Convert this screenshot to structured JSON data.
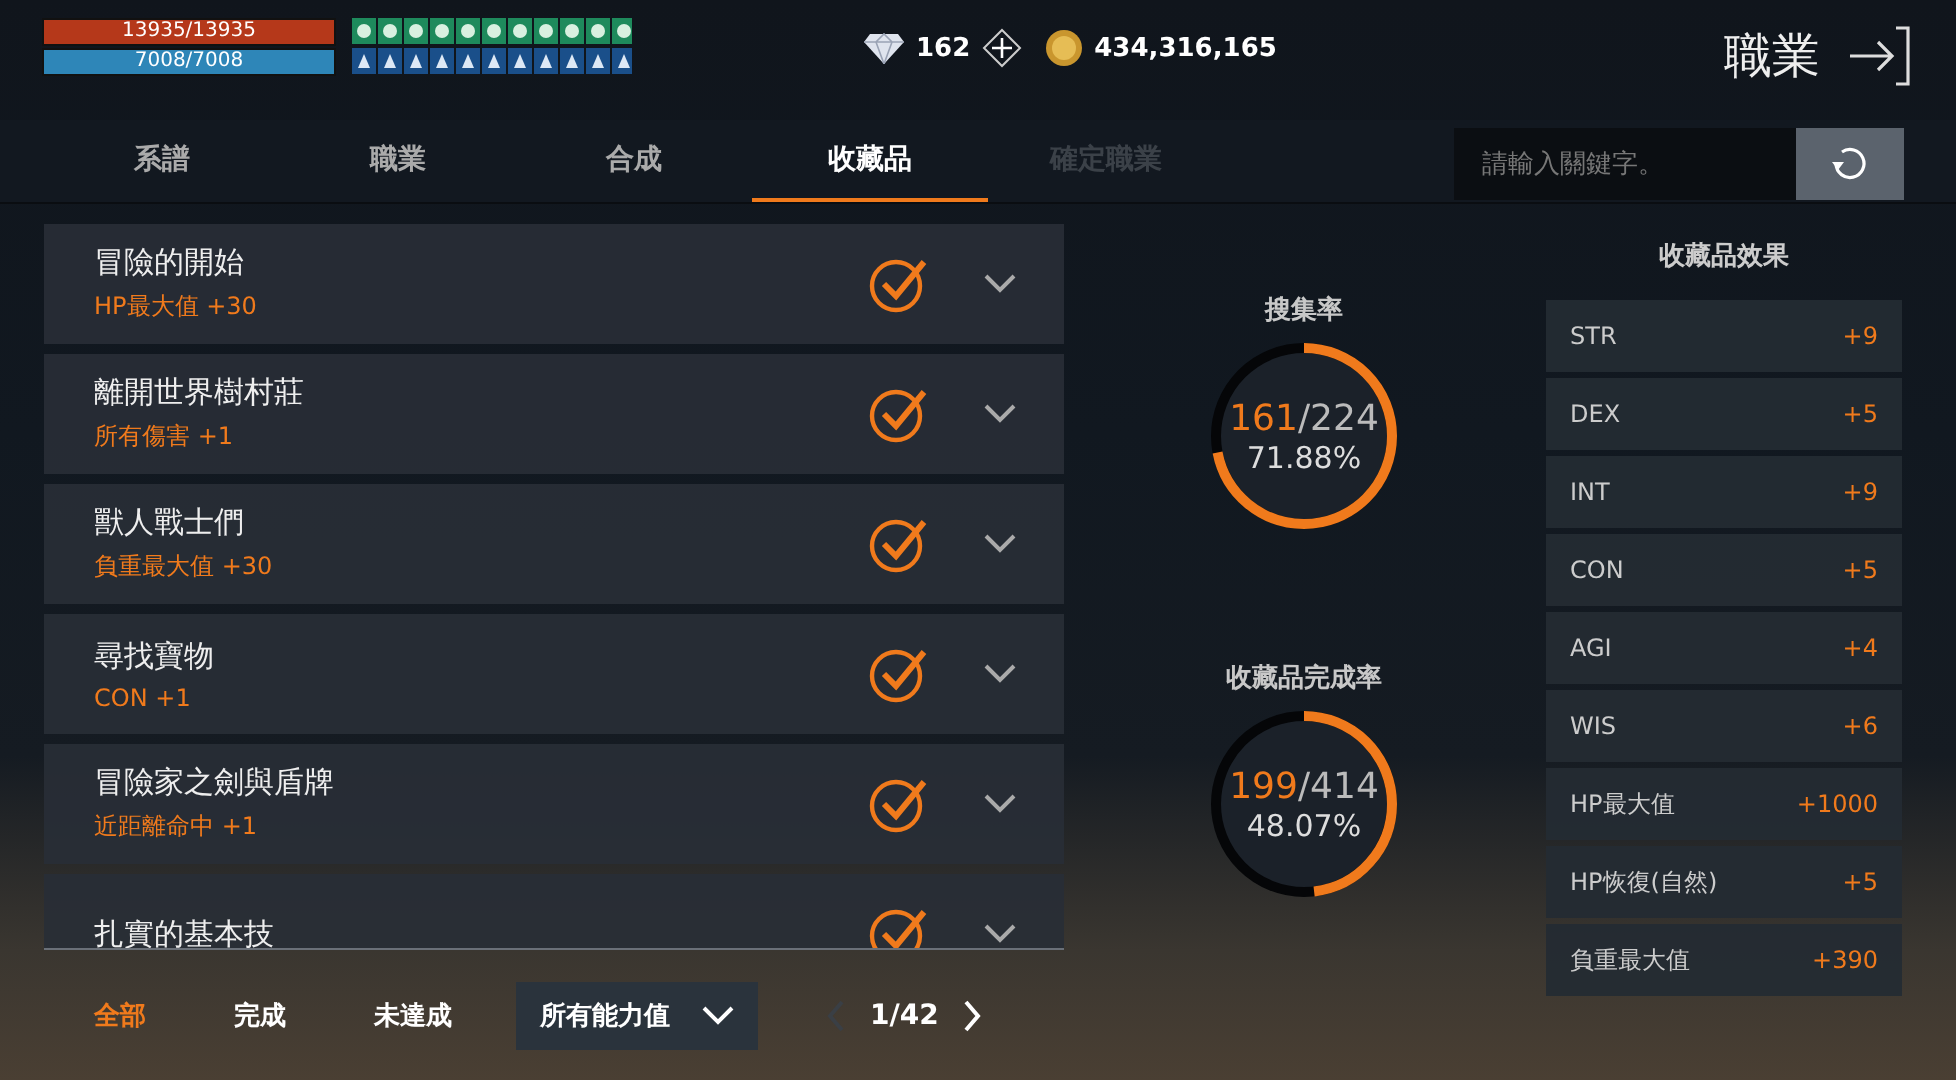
{
  "player": {
    "hp": {
      "text": "13935/13935",
      "level": 1
    },
    "mp": {
      "text": "7008/7008",
      "level": 1
    }
  },
  "currency": {
    "gems": "162",
    "gold": "434,316,165"
  },
  "header": {
    "title": "職業"
  },
  "tabs": [
    {
      "label": "系譜",
      "selected": false,
      "disabled": false
    },
    {
      "label": "職業",
      "selected": false,
      "disabled": false
    },
    {
      "label": "合成",
      "selected": false,
      "disabled": false
    },
    {
      "label": "收藏品",
      "selected": true,
      "disabled": false
    },
    {
      "label": "確定職業",
      "selected": false,
      "disabled": true
    }
  ],
  "search": {
    "placeholder": "請輸入關鍵字。"
  },
  "collections": [
    {
      "name": "冒險的開始",
      "effect": "HP最大值",
      "value": "+30",
      "completed": true
    },
    {
      "name": "離開世界樹村莊",
      "effect": "所有傷害",
      "value": "+1",
      "completed": true
    },
    {
      "name": "獸人戰士們",
      "effect": "負重最大值",
      "value": "+30",
      "completed": true
    },
    {
      "name": "尋找寶物",
      "effect": "CON",
      "value": "+1",
      "completed": true
    },
    {
      "name": "冒險家之劍與盾牌",
      "effect": "近距離命中",
      "value": "+1",
      "completed": true
    },
    {
      "name": "扎實的基本技",
      "completed": true
    }
  ],
  "rates": [
    {
      "title": "搜集率",
      "count": "161",
      "total": "/224",
      "percent": "71.88%"
    },
    {
      "title": "收藏品完成率",
      "count": "199",
      "total": "/414",
      "percent": "48.07%"
    }
  ],
  "effects": {
    "title": "收藏品效果",
    "items": [
      {
        "stat": "STR",
        "value": "+9"
      },
      {
        "stat": "DEX",
        "value": "+5"
      },
      {
        "stat": "INT",
        "value": "+9"
      },
      {
        "stat": "CON",
        "value": "+5"
      },
      {
        "stat": "AGI",
        "value": "+4"
      },
      {
        "stat": "WIS",
        "value": "+6"
      },
      {
        "stat": "HP最大值",
        "value": "+1000"
      },
      {
        "stat": "HP恢復(自然)",
        "value": "+5"
      },
      {
        "stat": "負重最大值",
        "value": "+390"
      }
    ]
  },
  "filters": [
    {
      "label": "全部",
      "selected": true
    },
    {
      "label": "完成",
      "selected": false
    },
    {
      "label": "未達成",
      "selected": false
    }
  ],
  "dropdown": {
    "value": "所有能力值"
  },
  "pager": {
    "page": "1/42",
    "prev_disabled": true
  }
}
